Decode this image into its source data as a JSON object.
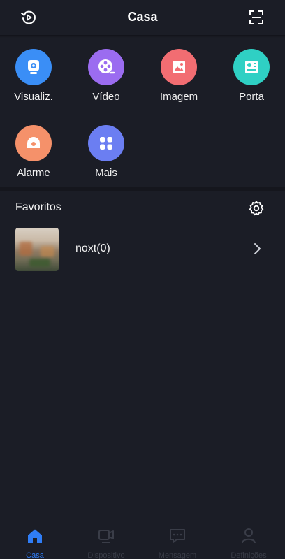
{
  "header": {
    "title": "Casa",
    "left_icon": "history-playback-icon",
    "right_icon": "scan-icon"
  },
  "grid": [
    {
      "label": "Visualiz.",
      "icon": "camera-icon",
      "color": "#3a8ef6"
    },
    {
      "label": "Vídeo",
      "icon": "film-reel-icon",
      "color": "#9b6cf0"
    },
    {
      "label": "Imagem",
      "icon": "picture-icon",
      "color": "#f26d72"
    },
    {
      "label": "Porta",
      "icon": "door-panel-icon",
      "color": "#2fd0c4"
    },
    {
      "label": "Alarme",
      "icon": "alarm-icon",
      "color": "#f5916a"
    },
    {
      "label": "Mais",
      "icon": "more-apps-icon",
      "color": "#6b7ef2"
    }
  ],
  "favorites": {
    "title": "Favoritos",
    "settings_icon": "gear-icon",
    "items": [
      {
        "name": "noxt(0)"
      }
    ]
  },
  "tabbar": {
    "active_color": "#2f7df6",
    "inactive_color": "#3a3d48",
    "tabs": [
      {
        "label": "Casa",
        "icon": "home-icon",
        "active": true
      },
      {
        "label": "Dispositivo",
        "icon": "device-icon",
        "active": false
      },
      {
        "label": "Mensagem",
        "icon": "message-icon",
        "active": false
      },
      {
        "label": "Definições",
        "icon": "user-icon",
        "active": false
      }
    ]
  }
}
